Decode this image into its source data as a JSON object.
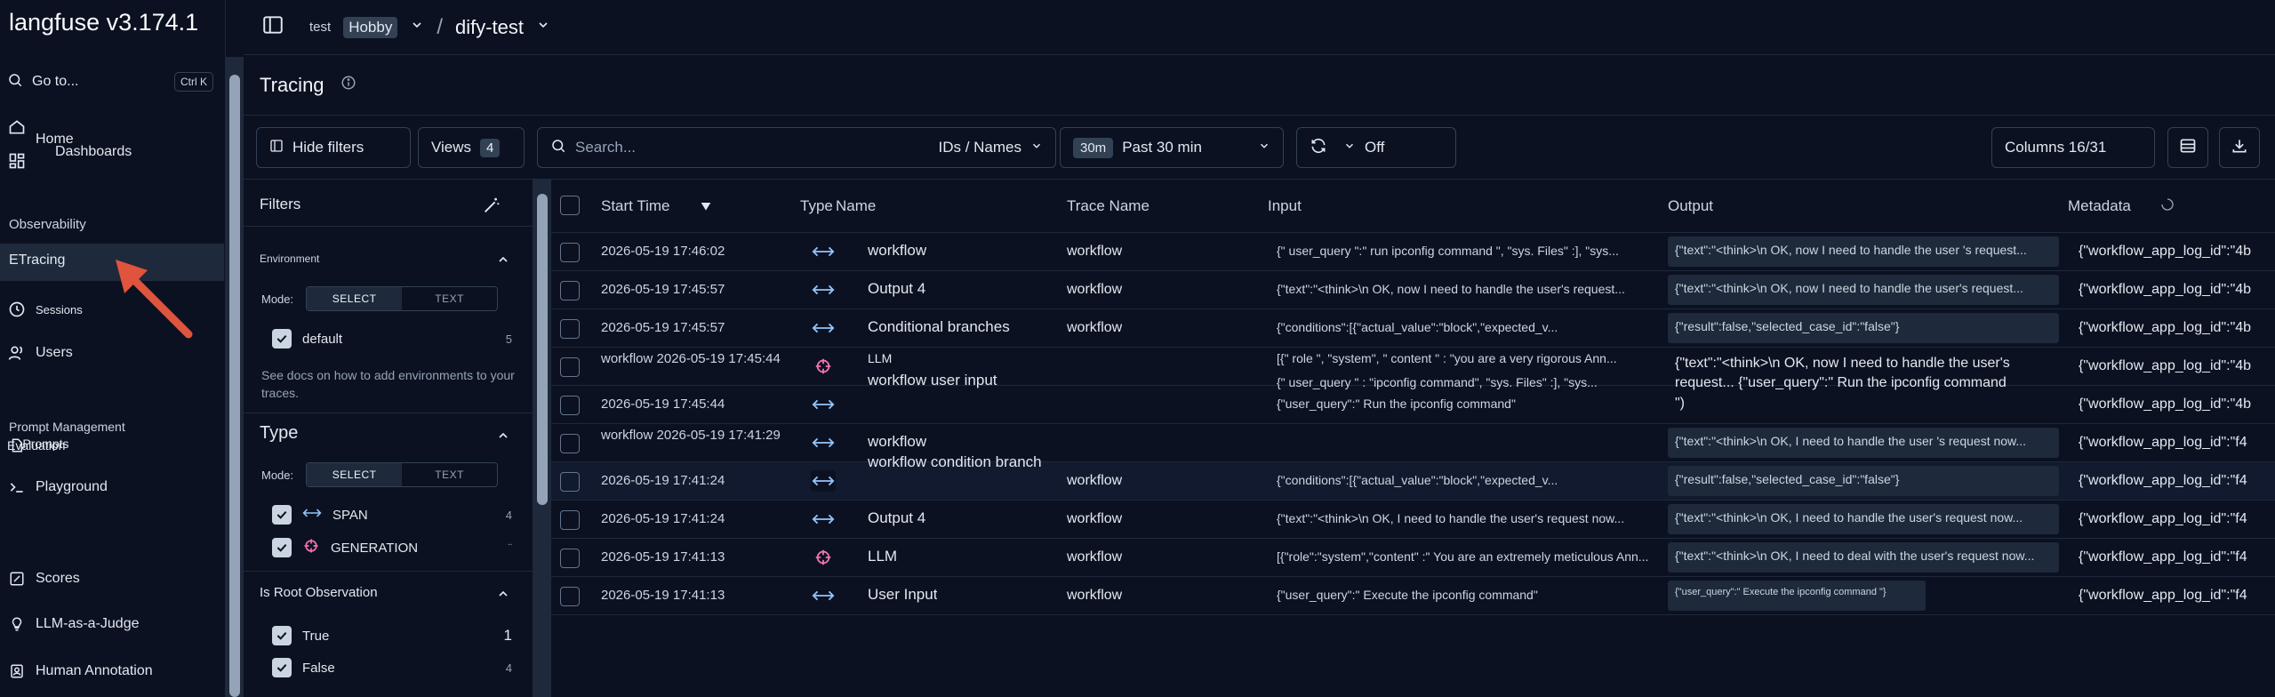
{
  "app": {
    "title": "langfuse v3.174.1"
  },
  "sidebar": {
    "goto_label": "Go to...",
    "goto_shortcut": "Ctrl K",
    "home": "Home",
    "dashboards": "Dashboards",
    "observability_label": "Observability",
    "tracing": "ETracing",
    "sessions": "Sessions",
    "users": "Users",
    "prompt_management_label": "Prompt Management",
    "prompts_overlap": "Evaluation",
    "prompts": "Prompts",
    "playground": "Playground",
    "scores": "Scores",
    "llm_judge": "LLM-as-a-Judge",
    "human_annotation": "Human Annotation"
  },
  "topbar": {
    "org": "test",
    "plan": "Hobby",
    "project": "dify-test"
  },
  "page": {
    "title": "Tracing"
  },
  "toolbar": {
    "hide_filters": "Hide filters",
    "views_label": "Views",
    "views_count": "4",
    "search_placeholder": "Search...",
    "search_scope": "IDs / Names",
    "time_badge": "30m",
    "time_range": "Past 30 min",
    "refresh_state": "Off",
    "columns": "Columns 16/31"
  },
  "filters": {
    "title": "Filters",
    "environment_label": "Environment",
    "mode_label": "Mode:",
    "mode_select": "SELECT",
    "mode_text": "TEXT",
    "env_option": "default",
    "env_count": "5",
    "env_hint": "See docs on how to add environments to your traces.",
    "type_label": "Type",
    "type_span": "SPAN",
    "type_span_count": "4",
    "type_generation": "GENERATION",
    "type_generation_count": "¨",
    "root_label": "Is Root Observation",
    "root_true": "True",
    "root_true_count": "1",
    "root_false": "False",
    "root_false_count": "4"
  },
  "table": {
    "headers": {
      "start_time": "Start Time",
      "type": "Type",
      "name": "Name",
      "trace_name": "Trace Name",
      "input": "Input",
      "output": "Output",
      "metadata": "Metadata"
    },
    "rows": [
      {
        "time": "2026-05-19 17:46:02",
        "type": "span",
        "name": "workflow",
        "trace": "workflow",
        "input": "{\" user_query \":\" run ipconfig command \", \"sys. Files\" :], \"sys...",
        "output": "{\"text\":\"<think>\\n OK, now I need to handle the user 's request...",
        "meta": "{\"workflow_app_log_id\":\"4b"
      },
      {
        "time": "2026-05-19 17:45:57",
        "type": "span",
        "name": "Output 4",
        "trace": "workflow",
        "input": "{\"text\":\"<think>\\n OK, now I need to handle the user's request...",
        "output": "{\"text\":\"<think>\\n OK, now I need to handle the user's request...",
        "meta": "{\"workflow_app_log_id\":\"4b"
      },
      {
        "time": "2026-05-19 17:45:57",
        "type": "span",
        "name": "Conditional branches",
        "trace": "workflow",
        "input": "{\"conditions\":[{\"actual_value\":\"block\",\"expected_v...",
        "output": "{\"result\":false,\"selected_case_id\":\"false\"}",
        "meta": "{\"workflow_app_log_id\":\"4b"
      },
      {
        "time": "workflow 2026-05-19 17:45:44",
        "type": "generation",
        "name": "LLM",
        "trace": "",
        "input": "[{\" role \", \"system\", \" content \" : \"you are a very rigorous Ann...",
        "output": "{\"text\":\"<think>\\n OK, now I need to handle the user's",
        "meta": "{\"workflow_app_log_id\":\"4b"
      },
      {
        "time": "2026-05-19 17:45:44",
        "type": "span",
        "name": "",
        "trace": "",
        "input": "{\"user_query\":\" Run the ipconfig command\"",
        "output": "\")",
        "meta": "{\"workflow_app_log_id\":\"4b"
      },
      {
        "time": "workflow 2026-05-19 17:41:29",
        "type": "span",
        "name": "workflow",
        "trace": "",
        "input": "",
        "output": "{\"text\":\"<think>\\n OK, I need to handle the user 's request now...",
        "meta": "{\"workflow_app_log_id\":\"f4"
      },
      {
        "time": "2026-05-19 17:41:24",
        "type": "span",
        "name": "",
        "trace": "workflow",
        "input": "{\"conditions\":[{\"actual_value\":\"block\",\"expected_v...",
        "output": "{\"result\":false,\"selected_case_id\":\"false\"}",
        "meta": "{\"workflow_app_log_id\":\"f4"
      },
      {
        "time": "2026-05-19 17:41:24",
        "type": "span",
        "name": "Output 4",
        "trace": "workflow",
        "input": "{\"text\":\"<think>\\n OK, I need to handle the user's request now...",
        "output": "{\"text\":\"<think>\\n OK, I need to handle the user's request now...",
        "meta": "{\"workflow_app_log_id\":\"f4"
      },
      {
        "time": "2026-05-19 17:41:13",
        "type": "generation",
        "name": "LLM",
        "trace": "workflow",
        "input": "[{\"role\":\"system\",\"content\" :\" You are an extremely meticulous Ann...",
        "output": "{\"text\":\"<think>\\n OK, I need to deal with the user's request now...",
        "meta": "{\"workflow_app_log_id\":\"f4"
      },
      {
        "time": "2026-05-19 17:41:13",
        "type": "span",
        "name": "User Input",
        "trace": "workflow",
        "input": "{\"user_query\":\" Execute the ipconfig command\"",
        "output": "{\"user_query\":\" Execute the ipconfig command \"}",
        "meta": "{\"workflow_app_log_id\":\"f4"
      }
    ],
    "overlays": {
      "llm_sub": "workflow user input",
      "llm_sub2": "{\" user_query \" : \"ipconfig command\", \"sys. Files\" :], \"sys...",
      "llm_out2": "request... {\"user_query\":\" Run the ipconfig command",
      "cond_branch": "workflow condition branch"
    }
  }
}
